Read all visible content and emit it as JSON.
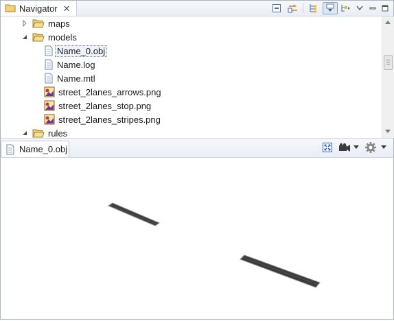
{
  "navigator": {
    "title": "Navigator",
    "toolbar": [
      {
        "icon": "collapse-all-icon"
      },
      {
        "icon": "link-with-editor-icon"
      },
      {
        "icon": "tree-layout-icon"
      },
      {
        "icon": "filter-icon",
        "active": true
      },
      {
        "icon": "show-hierarchy-icon"
      },
      {
        "icon": "view-menu-icon"
      },
      {
        "icon": "minimize-icon"
      },
      {
        "icon": "maximize-icon"
      }
    ],
    "tree": [
      {
        "label": "maps",
        "type": "folder",
        "expanded": false
      },
      {
        "label": "models",
        "type": "folder",
        "expanded": true
      },
      {
        "label": "Name_0.obj",
        "type": "file",
        "selected": true
      },
      {
        "label": "Name.log",
        "type": "file"
      },
      {
        "label": "Name.mtl",
        "type": "file"
      },
      {
        "label": "street_2lanes_arrows.png",
        "type": "image"
      },
      {
        "label": "street_2lanes_stop.png",
        "type": "image"
      },
      {
        "label": "street_2lanes_stripes.png",
        "type": "image"
      },
      {
        "label": "rules",
        "type": "folder",
        "expanded": true
      }
    ]
  },
  "editor": {
    "tab_label": "Name_0.obj",
    "toolbar": [
      {
        "icon": "fit-view-icon"
      },
      {
        "icon": "camera-icon"
      },
      {
        "icon": "camera-dropdown-icon"
      },
      {
        "icon": "settings-gear-icon"
      },
      {
        "icon": "settings-dropdown-icon"
      }
    ]
  },
  "colors": {
    "folder": "#e8c25a",
    "header_bg": "#e9eef5",
    "street_fill": "#3a3a3a",
    "street_edge": "#8c8c8c",
    "selection": "#eef3fb"
  }
}
